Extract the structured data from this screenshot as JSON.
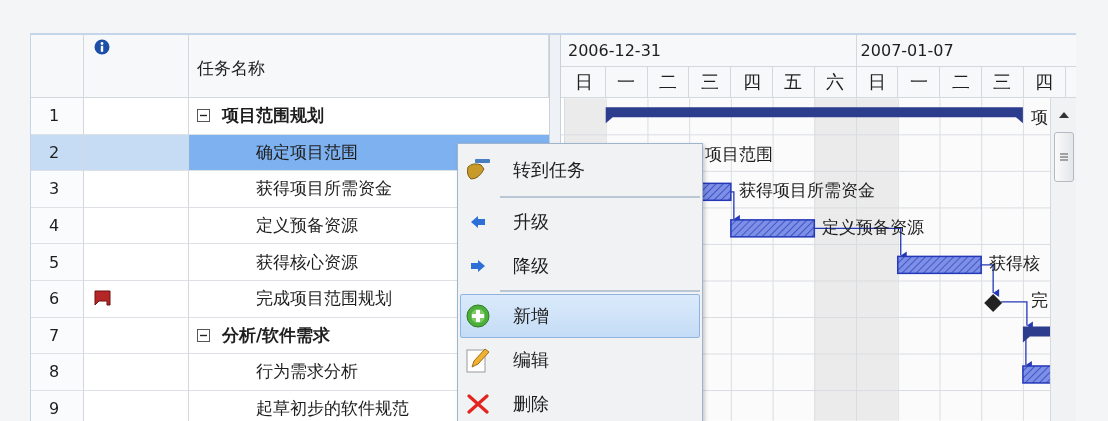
{
  "table": {
    "name_header": "任务名称",
    "rows": [
      {
        "number": "1",
        "name": "项目范围规划",
        "summary": true,
        "expanded": true,
        "selected": false,
        "flagged": false,
        "children": [
          {
            "number": "2",
            "name": "确定项目范围",
            "summary": false,
            "selected": true,
            "flagged": false
          },
          {
            "number": "3",
            "name": "获得项目所需资金",
            "summary": false,
            "selected": false,
            "flagged": false
          },
          {
            "number": "4",
            "name": "定义预备资源",
            "summary": false,
            "selected": false,
            "flagged": false
          },
          {
            "number": "5",
            "name": "获得核心资源",
            "summary": false,
            "selected": false,
            "flagged": false
          },
          {
            "number": "6",
            "name": "完成项目范围规划",
            "summary": false,
            "selected": false,
            "flagged": true
          }
        ]
      },
      {
        "number": "7",
        "name": "分析/软件需求",
        "summary": true,
        "expanded": true,
        "selected": false,
        "flagged": false,
        "children": [
          {
            "number": "8",
            "name": "行为需求分析",
            "summary": false,
            "selected": false,
            "flagged": false
          },
          {
            "number": "9",
            "name": "起草初步的软件规范",
            "summary": false,
            "selected": false,
            "flagged": false
          }
        ]
      }
    ]
  },
  "gantt": {
    "weeks": [
      {
        "label": "2006-12-31",
        "days": [
          {
            "label": "日",
            "nonworking": true
          },
          {
            "label": "一",
            "nonworking": false
          },
          {
            "label": "二",
            "nonworking": false
          },
          {
            "label": "三",
            "nonworking": false
          },
          {
            "label": "四",
            "nonworking": false
          },
          {
            "label": "五",
            "nonworking": false
          },
          {
            "label": "六",
            "nonworking": true
          }
        ]
      },
      {
        "label": "2007-01-07",
        "days": [
          {
            "label": "日",
            "nonworking": true
          },
          {
            "label": "一",
            "nonworking": false
          },
          {
            "label": "二",
            "nonworking": false
          },
          {
            "label": "三",
            "nonworking": false
          },
          {
            "label": "四",
            "nonworking": false
          }
        ]
      }
    ],
    "bars": [
      {
        "kind": "summary",
        "label": "项"
      },
      {
        "kind": "label",
        "label": "项目范围"
      },
      {
        "kind": "task",
        "label": "获得项目所需资金"
      },
      {
        "kind": "task",
        "label": "定义预备资源"
      },
      {
        "kind": "task",
        "label": "获得核"
      },
      {
        "kind": "milestone",
        "label": "完"
      },
      {
        "kind": "summary"
      },
      {
        "kind": "task"
      }
    ]
  },
  "context_menu": {
    "items": [
      {
        "kind": "item",
        "label": "转到任务",
        "selected": false
      },
      {
        "kind": "separator"
      },
      {
        "kind": "item",
        "label": "升级",
        "selected": false
      },
      {
        "kind": "item",
        "label": "降级",
        "selected": false
      },
      {
        "kind": "separator"
      },
      {
        "kind": "item",
        "label": "新增",
        "selected": true
      },
      {
        "kind": "item",
        "label": "编辑",
        "selected": false
      },
      {
        "kind": "item",
        "label": "删除",
        "selected": false
      }
    ]
  }
}
